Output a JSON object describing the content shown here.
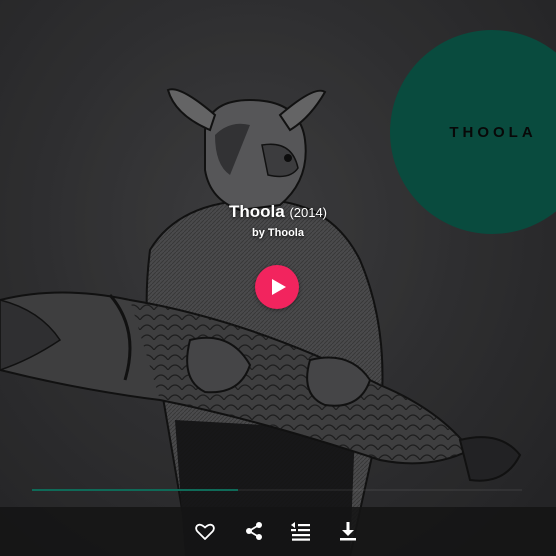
{
  "album": {
    "title": "Thoola",
    "year": "(2014)",
    "artist_prefix": "by",
    "artist": "Thoola"
  },
  "artwork": {
    "logo_text": "THOOLA",
    "logo_color": "#0c5c4c",
    "description_icon": "bear-holding-fish-illustration"
  },
  "player": {
    "play_icon": "play-icon",
    "play_color": "#f2245e",
    "progress_color": "#0f6a58",
    "progress_fraction": 0.42
  },
  "actions": [
    {
      "icon": "heart-icon"
    },
    {
      "icon": "share-icon"
    },
    {
      "icon": "playlist-add-icon"
    },
    {
      "icon": "download-icon"
    }
  ]
}
